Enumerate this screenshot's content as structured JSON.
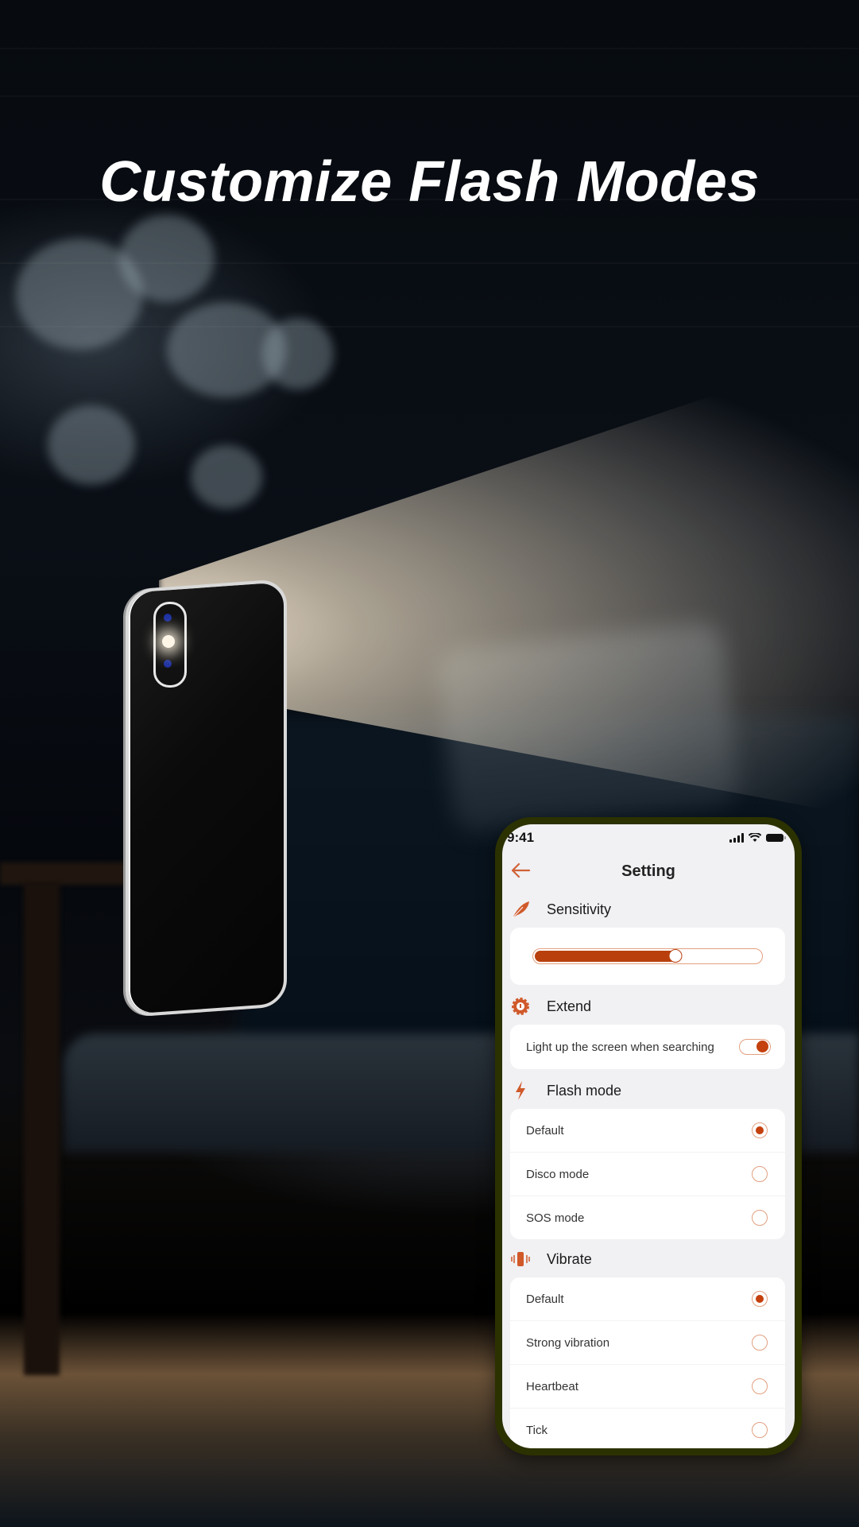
{
  "headline": "Customize Flash Modes",
  "colors": {
    "accent": "#c4400c",
    "frame": "#2c3100",
    "screen_bg": "#f1f0f3"
  },
  "status_bar": {
    "time": "9:41",
    "icons": [
      "signal-icon",
      "wifi-icon",
      "battery-icon"
    ]
  },
  "nav": {
    "back_icon": "arrow-left-icon",
    "title": "Setting"
  },
  "sections": {
    "sensitivity": {
      "icon": "feather-icon",
      "label": "Sensitivity",
      "slider_value_percent": 62
    },
    "extend": {
      "icon": "gear-icon",
      "label": "Extend",
      "toggle_label": "Light up the screen when searching",
      "toggle_on": true
    },
    "flash_mode": {
      "icon": "lightning-icon",
      "label": "Flash mode",
      "options": [
        {
          "label": "Default",
          "selected": true
        },
        {
          "label": "Disco mode",
          "selected": false
        },
        {
          "label": "SOS mode",
          "selected": false
        }
      ]
    },
    "vibrate": {
      "icon": "vibrate-icon",
      "label": "Vibrate",
      "options": [
        {
          "label": "Default",
          "selected": true
        },
        {
          "label": "Strong vibration",
          "selected": false
        },
        {
          "label": "Heartbeat",
          "selected": false
        },
        {
          "label": "Tick",
          "selected": false
        }
      ]
    }
  }
}
